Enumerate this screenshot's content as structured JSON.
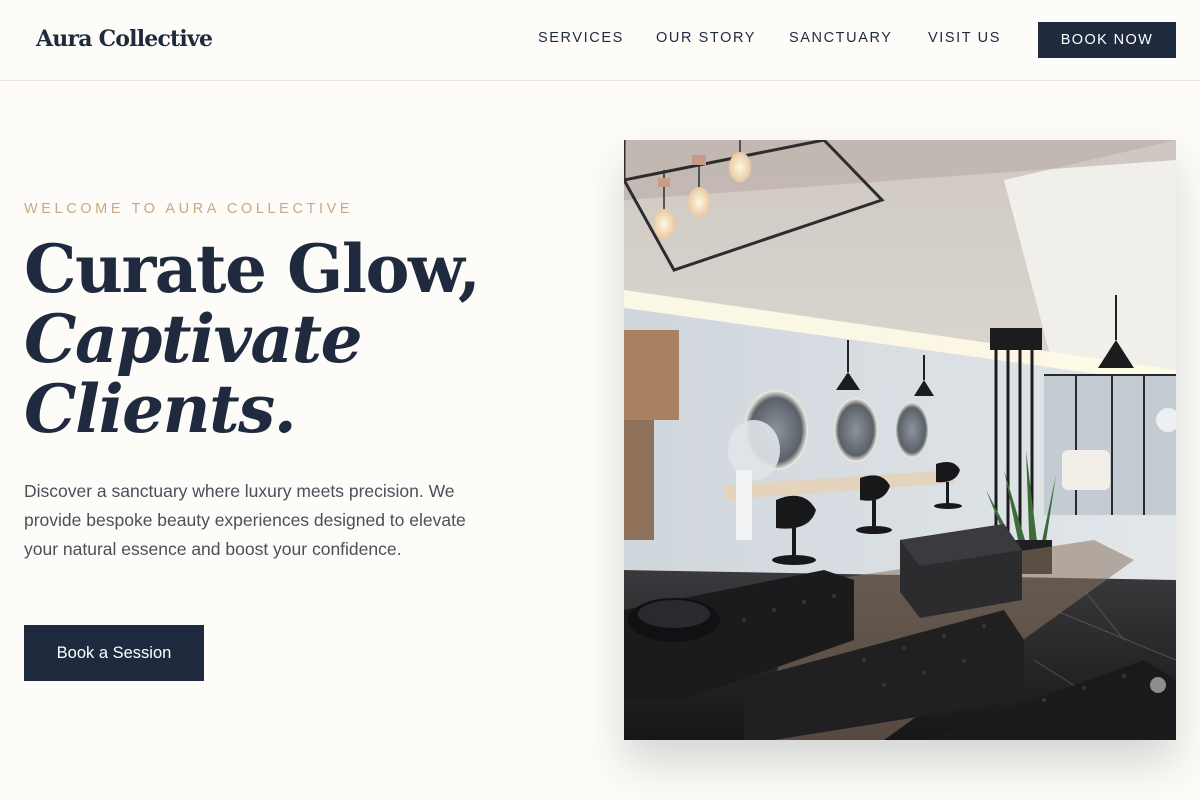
{
  "header": {
    "logo": "Aura Collective",
    "nav": [
      "SERVICES",
      "OUR STORY",
      "SANCTUARY",
      "VISIT US"
    ],
    "book_now": "BOOK NOW"
  },
  "hero": {
    "eyebrow": "WELCOME TO AURA COLLECTIVE",
    "headline": [
      "Curate Glow,",
      "Captivate",
      "Clients."
    ],
    "description": "Discover a sanctuary where luxury meets precision. We provide bespoke beauty experiences designed to elevate your natural essence and boost your confidence.",
    "cta": "Book a Session"
  },
  "colors": {
    "navy": "#1f2a3f",
    "gold": "#c9a983",
    "background": "#fdfcf8",
    "body_text": "#4a4f5a"
  }
}
